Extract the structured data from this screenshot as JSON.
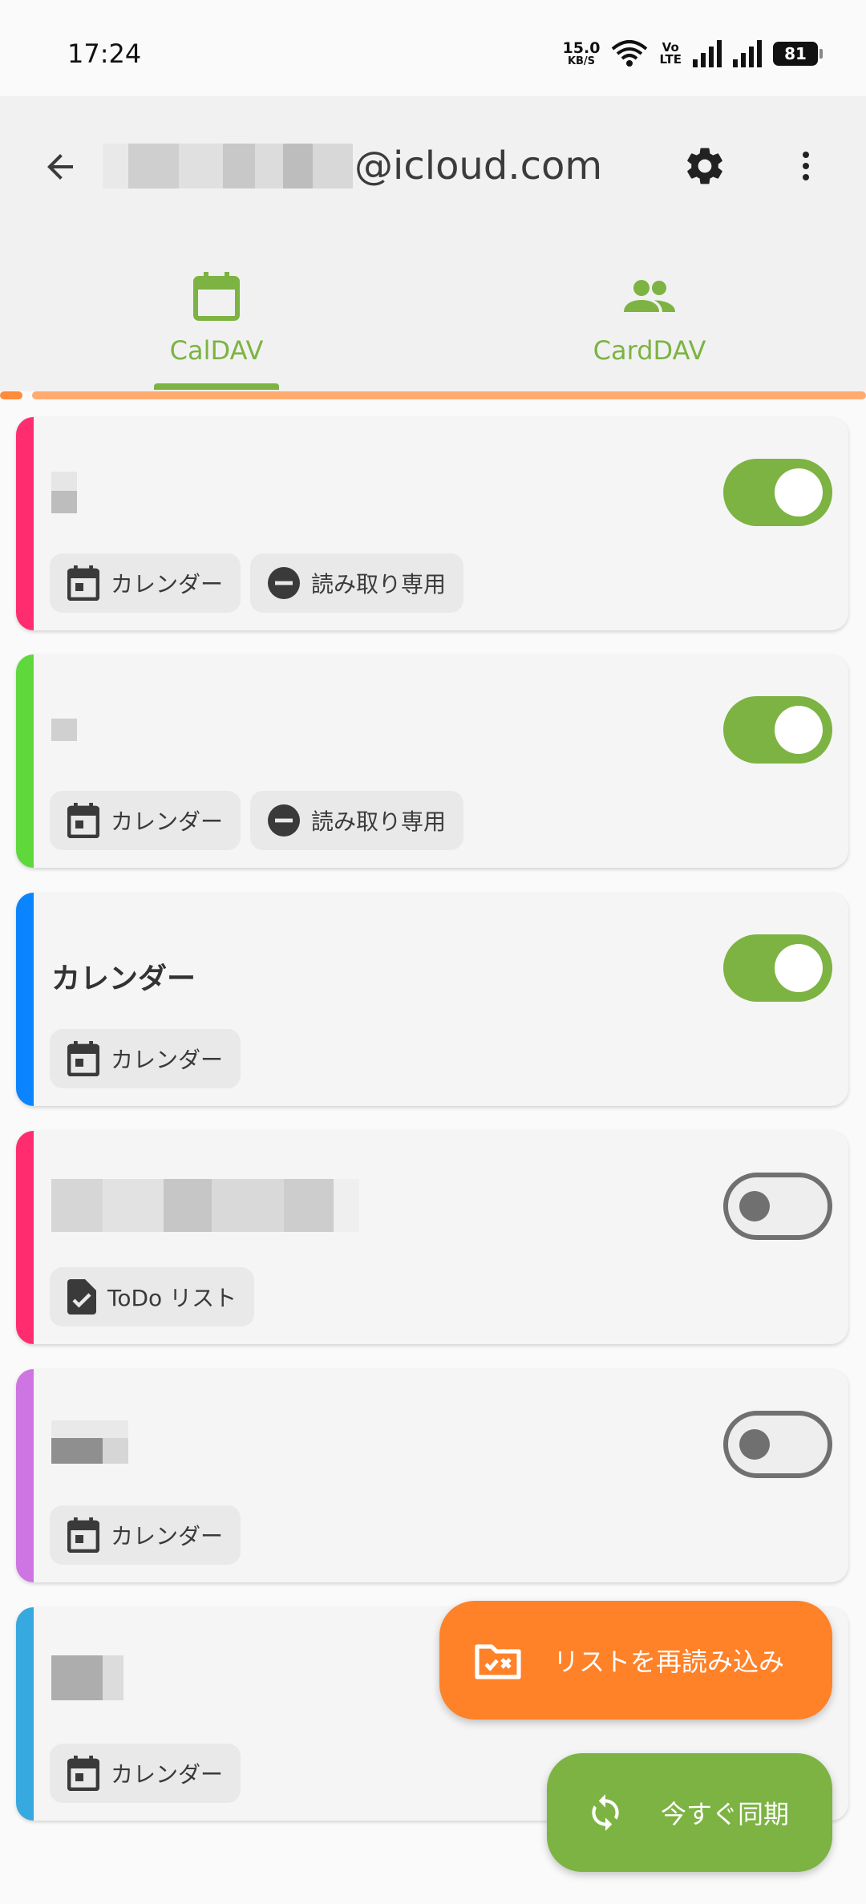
{
  "status_bar": {
    "time": "17:24",
    "net_speed": "15.0",
    "net_unit": "KB/S",
    "volte_line1": "Vo",
    "volte_line2": "LTE",
    "battery": "81"
  },
  "app_bar": {
    "account_suffix": "@icloud.com",
    "back_icon": "arrow-back-icon",
    "settings_icon": "gear-icon",
    "more_icon": "more-vert-icon"
  },
  "tabs": [
    {
      "label": "CalDAV",
      "icon": "calendar-icon",
      "selected": true
    },
    {
      "label": "CardDAV",
      "icon": "people-icon",
      "selected": false
    }
  ],
  "colors": {
    "accent": "#7cb342",
    "fab_refresh": "#ff8128",
    "progress": "#ffab70"
  },
  "collections": [
    {
      "name": "",
      "color": "#ff2d6f",
      "enabled": true,
      "chips": [
        "カレンダー",
        "読み取り専用"
      ]
    },
    {
      "name": "",
      "color": "#5fd83c",
      "enabled": true,
      "chips": [
        "カレンダー",
        "読み取り専用"
      ]
    },
    {
      "name": "カレンダー",
      "color": "#0a84ff",
      "enabled": true,
      "chips": [
        "カレンダー"
      ]
    },
    {
      "name": "",
      "color": "#ff2d6f",
      "enabled": false,
      "chips": [
        "ToDo リスト"
      ]
    },
    {
      "name": "",
      "color": "#cf74e3",
      "enabled": false,
      "chips": [
        "カレンダー"
      ]
    },
    {
      "name": "",
      "color": "#36a9e0",
      "enabled": true,
      "chips": [
        "カレンダー"
      ]
    }
  ],
  "fabs": {
    "refresh_label": "リストを再読み込み",
    "sync_label": "今すぐ同期"
  }
}
